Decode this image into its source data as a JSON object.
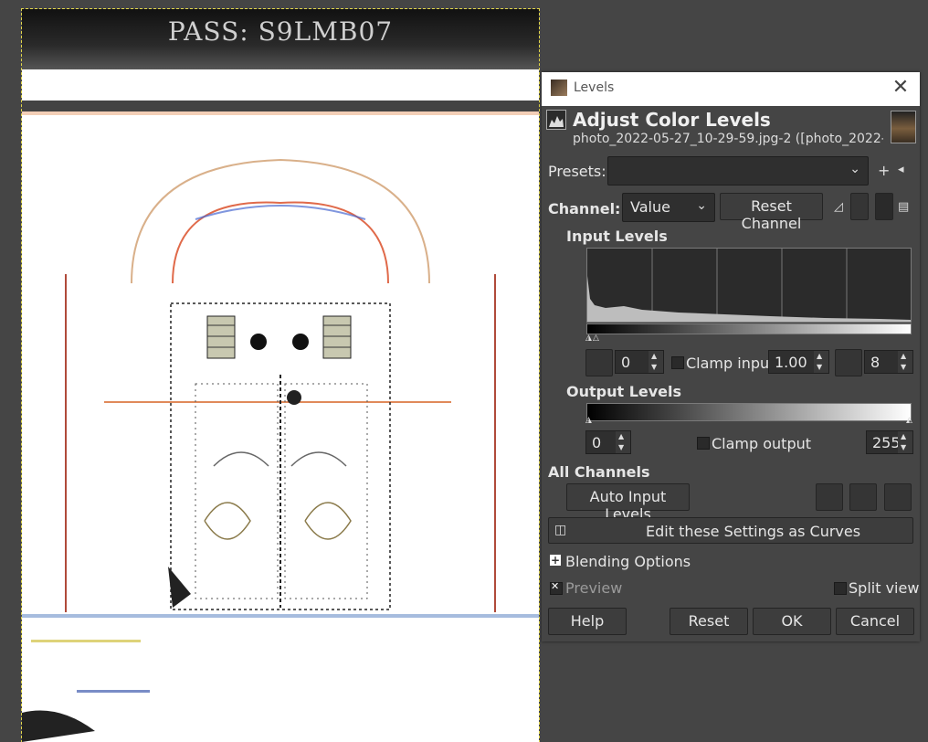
{
  "canvas": {
    "pass_text": "PASS: S9LMB07"
  },
  "dialog": {
    "window_title": "Levels",
    "header_title": "Adjust Color Levels",
    "header_subtitle": "photo_2022-05-27_10-29-59.jpg-2 ([photo_2022-0...",
    "presets_label": "Presets:",
    "presets_value": "",
    "channel_label": "Channel:",
    "channel_value": "Value",
    "reset_channel_label": "Reset Channel",
    "input_levels": {
      "title": "Input Levels",
      "low": "0",
      "clamp_label": "Clamp input",
      "gamma": "1.00",
      "high": "8",
      "clamp_checked": false
    },
    "output_levels": {
      "title": "Output Levels",
      "low": "0",
      "clamp_label": "Clamp output",
      "high": "255",
      "clamp_checked": false
    },
    "all_channels": {
      "title": "All Channels",
      "auto_label": "Auto Input Levels"
    },
    "curves_label": "Edit these Settings as Curves",
    "blending_label": "Blending Options",
    "preview_label": "Preview",
    "preview_checked": true,
    "split_view_label": "Split view",
    "split_view_checked": false,
    "buttons": {
      "help": "Help",
      "reset": "Reset",
      "ok": "OK",
      "cancel": "Cancel"
    }
  },
  "colors": {
    "dialog_bg": "#454545",
    "canvas_bg": "#ffffff",
    "selection_outline": "#e2d64a"
  }
}
